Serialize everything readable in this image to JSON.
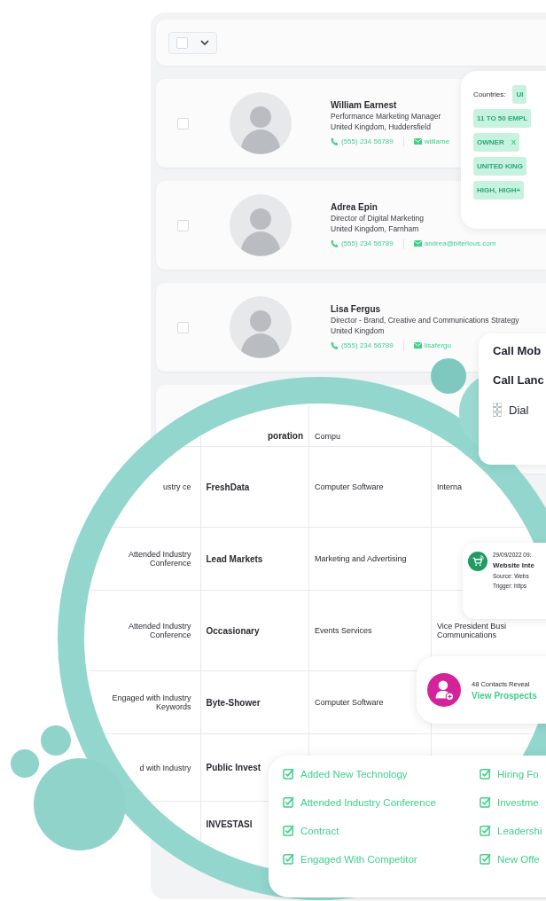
{
  "toolbar": {
    "select_all": {
      "checked": false
    }
  },
  "contacts": [
    {
      "name": "William Earnest",
      "title": "Performance Marketing Manager",
      "location": "United Kingdom, Huddersfield",
      "phone": "(555) 234 56789",
      "email": "williame",
      "checked": false
    },
    {
      "name": "Adrea Epin",
      "title": "Director of Digital Marketing",
      "location": "United Kingdom, Farnham",
      "phone": "(555) 234 56789",
      "email": "andrea@biterious.com",
      "checked": false
    },
    {
      "name": "Lisa Fergus",
      "title": "Director - Brand, Creative and Communications Strategy",
      "location": "United Kingdom",
      "phone": "(555) 234 56789",
      "email": "lisafergu",
      "checked": false
    }
  ],
  "filters": {
    "label": "Countries:",
    "country_chip": "UI",
    "chips": [
      {
        "text": "11 TO 50 EMPL"
      },
      {
        "text": "OWNER",
        "remove": "X"
      },
      {
        "text": "UNITED KING"
      },
      {
        "text": "HIGH, HIGH+"
      }
    ]
  },
  "call_menu": {
    "items": [
      {
        "kind": "call",
        "label": "Call Mob"
      },
      {
        "kind": "call",
        "label": "Call Lanc"
      },
      {
        "kind": "dial",
        "label": "Dial"
      }
    ]
  },
  "table": {
    "rows": [
      {
        "column_2": "poration",
        "column_3": "Compu"
      },
      {
        "column_1": "ustry ce",
        "column_2": "FreshData",
        "column_3": "Computer Software",
        "column_4": "Interna"
      },
      {
        "column_1": "Attended Industry Conference",
        "column_2": "Lead Markets",
        "column_3": "Marketing and Advertising"
      },
      {
        "column_1": "Attended Industry Conference",
        "column_2": "Occasionary",
        "column_3": "Events Services",
        "column_4": "Vice President Busi Communications"
      },
      {
        "column_1": "Engaged with Industry Keywords",
        "column_2": "Byte-Shower",
        "column_3": "Computer Software"
      },
      {
        "column_1": "d with Industry",
        "column_2": "Public Invest"
      },
      {
        "column_2": "INVESTASI"
      }
    ]
  },
  "activity_card": {
    "date": "29/09/2022 09:",
    "title": "Website Inte",
    "source": "Source: Webs",
    "trigger": "Trigger: https"
  },
  "reveal_card": {
    "count": "48 Contacts Reveal",
    "link": "View Prospects"
  },
  "intent_checklist": {
    "columns": [
      [
        {
          "label": "Added New Technology",
          "checked": true
        },
        {
          "label": "Attended Industry Conference",
          "checked": true
        },
        {
          "label": "Contract",
          "checked": true
        },
        {
          "label": "Engaged With Competitor",
          "checked": true
        }
      ],
      [
        {
          "label": "Hiring Fo",
          "checked": true
        },
        {
          "label": "Investme",
          "checked": true
        },
        {
          "label": "Leadershi",
          "checked": true
        },
        {
          "label": "New Offe",
          "checked": true
        }
      ]
    ]
  }
}
